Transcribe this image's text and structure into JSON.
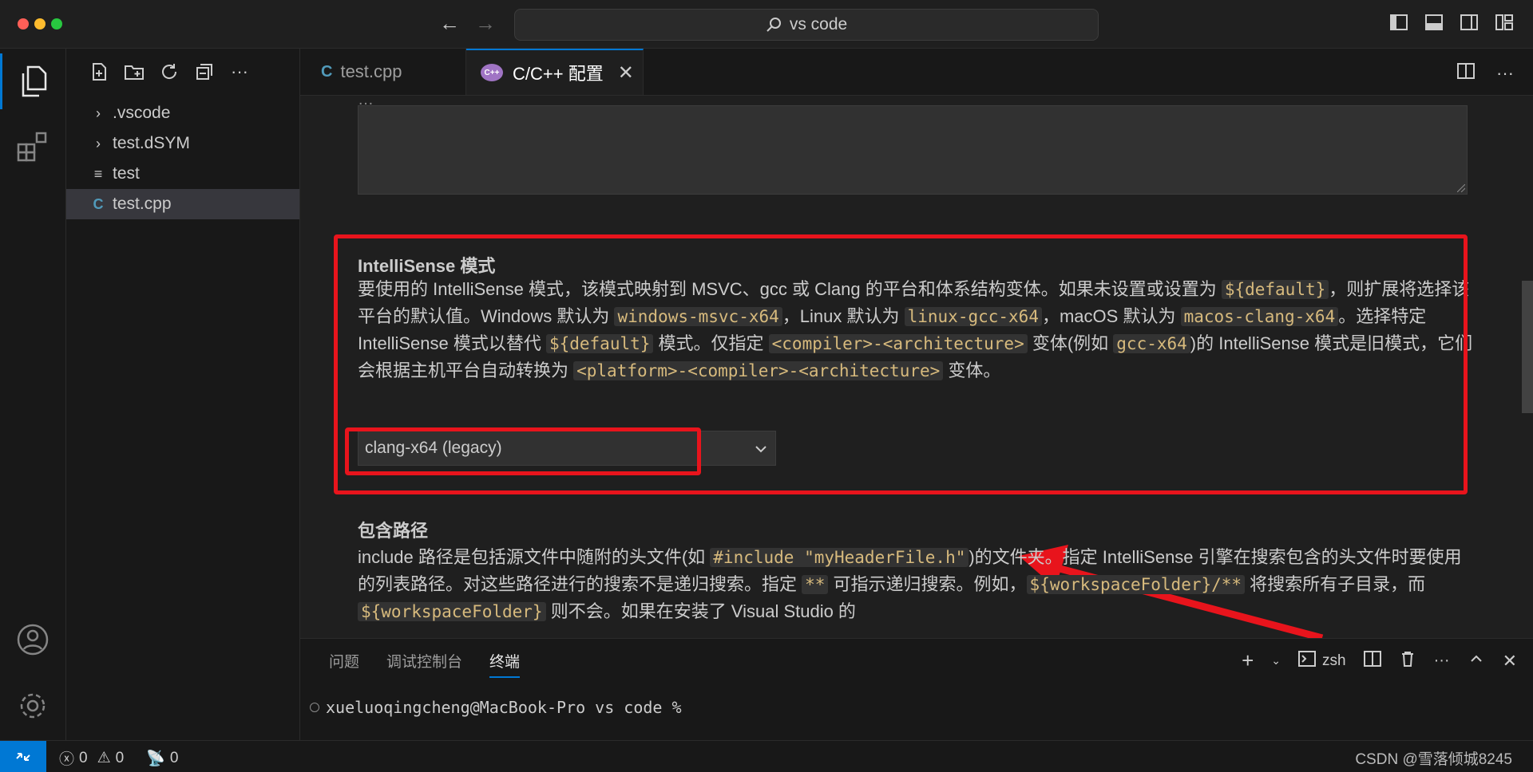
{
  "titlebar": {
    "back_icon": "arrow-left-icon",
    "forward_icon": "arrow-right-icon",
    "search_text": "vs code",
    "layout_icons": [
      "toggle-primary-sidebar-icon",
      "toggle-panel-icon",
      "toggle-secondary-sidebar-icon",
      "customize-layout-icon"
    ]
  },
  "activity": {
    "items": [
      "explorer-icon",
      "extensions-icon"
    ],
    "bottom": [
      "account-icon",
      "settings-gear-icon"
    ]
  },
  "sidebar": {
    "toolbar_icons": [
      "new-file-icon",
      "new-folder-icon",
      "refresh-icon",
      "collapse-all-icon",
      "more-icon"
    ],
    "tree": [
      {
        "label": ".vscode",
        "type": "folder"
      },
      {
        "label": "test.dSYM",
        "type": "folder"
      },
      {
        "label": "test",
        "type": "file"
      },
      {
        "label": "test.cpp",
        "type": "cpp",
        "selected": true
      }
    ]
  },
  "tabs": [
    {
      "label": "test.cpp",
      "active": false
    },
    {
      "label": "C/C++ 配置",
      "active": true
    }
  ],
  "editor": {
    "top_partial_text": "…",
    "intellisense": {
      "title": "IntelliSense 模式",
      "desc": {
        "p1": "要使用的 IntelliSense 模式，该模式映射到 MSVC、gcc 或 Clang 的平台和体系结构变体。如果未设置或设置为 ",
        "c1": "${default}",
        "p2": "，则扩展将选择该平台的默认值。Windows 默认为 ",
        "c2": "windows-msvc-x64",
        "p3": "，Linux 默认为 ",
        "c3": "linux-gcc-x64",
        "p4": "，macOS 默认为 ",
        "c4": "macos-clang-x64",
        "p5": "。选择特定 IntelliSense 模式以替代 ",
        "c5": "${default}",
        "p6": " 模式。仅指定 ",
        "c6": "<compiler>-<architecture>",
        "p7": " 变体(例如 ",
        "c7": "gcc-x64",
        "p8": ")的 IntelliSense 模式是旧模式，它们会根据主机平台自动转换为 ",
        "c8": "<platform>-<compiler>-<architecture>",
        "p9": " 变体。"
      },
      "select_value": "clang-x64 (legacy)"
    },
    "include": {
      "title": "包含路径",
      "desc": {
        "p1": "include 路径是包括源文件中随附的头文件(如 ",
        "c1": "#include \"myHeaderFile.h\"",
        "p2": ")的文件夹。指定 IntelliSense 引擎在搜索包含的头文件时要使用的列表路径。对这些路径进行的搜索不是递归搜索。指定 ",
        "c2": "**",
        "p3": " 可指示递归搜索。例如，",
        "c3": "${workspaceFolder}/**",
        "p4": " 将搜索所有子目录，而 ",
        "c4": "${workspaceFolder}",
        "p5": " 则不会。如果在安装了 Visual Studio 的"
      }
    }
  },
  "panel": {
    "tabs": [
      "问题",
      "调试控制台",
      "终端"
    ],
    "active_tab": "终端",
    "shell_label": "zsh",
    "prompt": "xueluoqingcheng@MacBook-Pro vs code %"
  },
  "status": {
    "errors": "0",
    "warnings": "0",
    "ports": "0",
    "watermark": "CSDN @雪落倾城8245"
  },
  "colors": {
    "accent": "#0078d4",
    "highlight": "#e8141c",
    "code_text": "#d7ba7d"
  }
}
